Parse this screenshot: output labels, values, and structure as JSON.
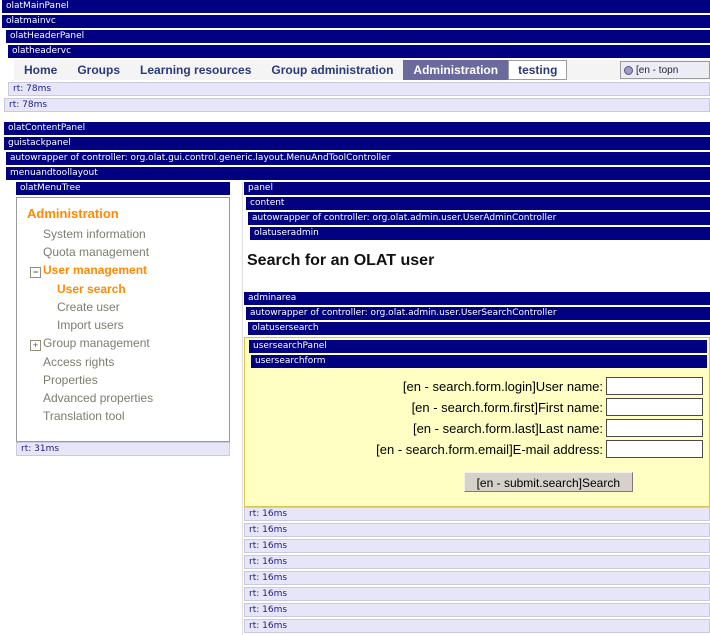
{
  "colors": {
    "debug_bar": "#010080",
    "rt_bg": "#E6E6F7",
    "tab_active_bg": "#6A6A9E",
    "menu_highlight": "#FF8A00",
    "form_bg": "#FFFFC4"
  },
  "debug": {
    "top_bars": [
      "olatMainPanel",
      "olatmainvc",
      "olatHeaderPanel",
      "olatheadervc"
    ],
    "rt_header": "rt: 78ms",
    "content_bars": [
      "olatContentPanel",
      "guistackpanel",
      "autowrapper of controller: org.olat.gui.control.generic.layout.MenuAndToolController",
      "menuandtoollayout"
    ],
    "menu_tree_bar": "olatMenuTree",
    "rt_menu": "rt: 31ms",
    "right_bars": [
      "panel",
      "content",
      "autowrapper of controller: org.olat.admin.user.UserAdminController",
      "olatuseradmin"
    ],
    "search_bars": [
      "adminarea",
      "autowrapper of controller: org.olat.admin.user.UserSearchController",
      "olatusersearch",
      "usersearchPanel",
      "usersearchform"
    ],
    "rt_content": "rt: 16ms"
  },
  "nav": {
    "tabs": [
      {
        "label": "Home"
      },
      {
        "label": "Groups"
      },
      {
        "label": "Learning resources"
      },
      {
        "label": "Group administration"
      },
      {
        "label": "Administration"
      },
      {
        "label": "testing"
      }
    ],
    "active_tab": "Administration",
    "topnav_label": "[en - topn"
  },
  "menu": {
    "root": "Administration",
    "items": [
      {
        "label": "System information"
      },
      {
        "label": "Quota management"
      },
      {
        "label": "User management",
        "expander_glyph": "−"
      },
      {
        "label": "User search"
      },
      {
        "label": "Create user"
      },
      {
        "label": "Import users"
      },
      {
        "label": "Group management",
        "expander_glyph": "+"
      },
      {
        "label": "Access rights"
      },
      {
        "label": "Properties"
      },
      {
        "label": "Advanced properties"
      },
      {
        "label": "Translation tool"
      }
    ]
  },
  "content": {
    "heading": "Search for an OLAT user",
    "form": {
      "fields": [
        {
          "label": "[en - search.form.login]User name:",
          "value": ""
        },
        {
          "label": "[en - search.form.first]First name:",
          "value": ""
        },
        {
          "label": "[en - search.form.last]Last name:",
          "value": ""
        },
        {
          "label": "[en - search.form.email]E-mail address:",
          "value": ""
        }
      ],
      "submit_label": "[en - submit.search]Search"
    }
  }
}
